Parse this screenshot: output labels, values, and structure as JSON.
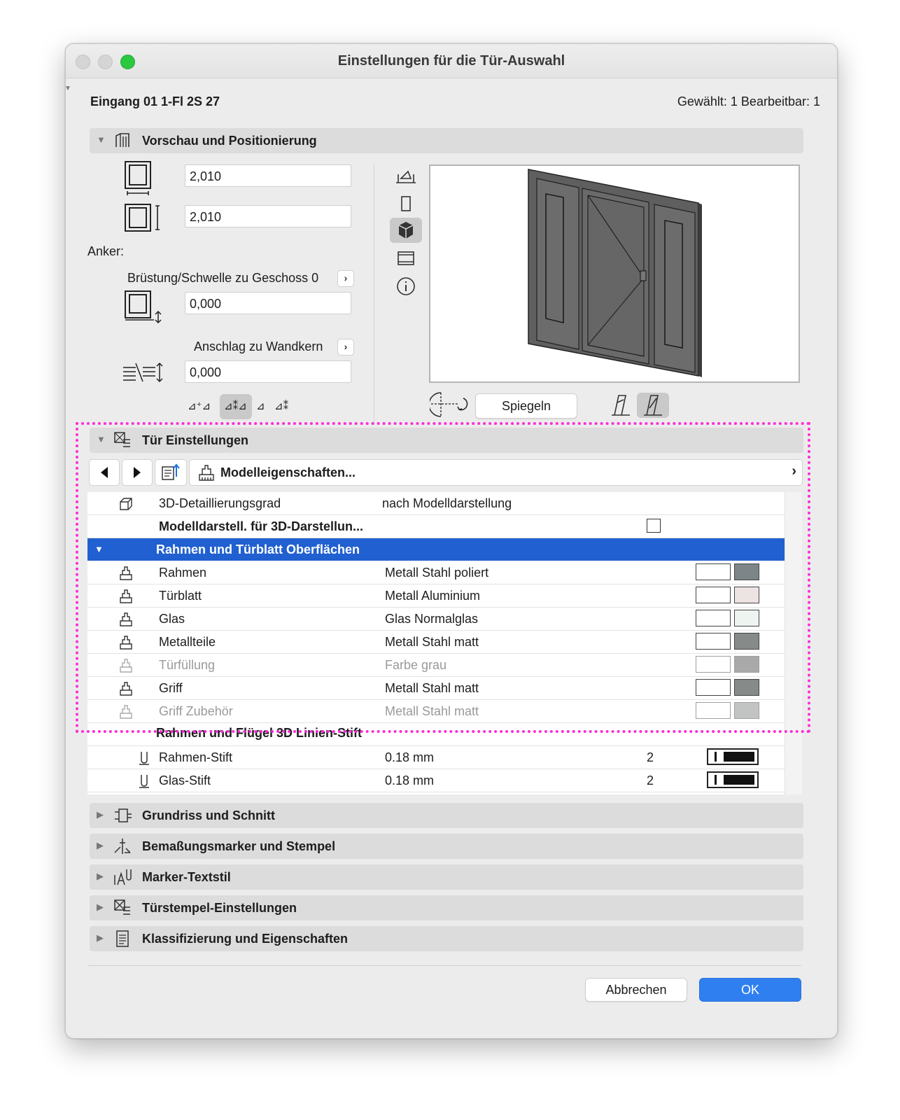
{
  "window": {
    "title": "Einstellungen für die Tür-Auswahl"
  },
  "header": {
    "element_name": "Eingang 01 1-Fl 2S 27",
    "selection_info": "Gewählt: 1 Bearbeitbar: 1"
  },
  "preview_section": {
    "title": "Vorschau und Positionierung",
    "width_value": "2,010",
    "height_value": "2,010",
    "anchor_label": "Anker:",
    "sill_label": "Brüstung/Schwelle zu Geschoss 0",
    "sill_value": "0,000",
    "reveal_label": "Anschlag zu Wandkern",
    "reveal_value": "0,000",
    "mirror_button": "Spiegeln"
  },
  "door_settings": {
    "title": "Tür Einstellungen",
    "dropdown_label": "Modelleigenschaften...",
    "rows": [
      {
        "label": "3D-Detaillierungsgrad",
        "value": "nach Modelldarstellung"
      },
      {
        "label": "Modelldarstell. für 3D-Darstellun..."
      }
    ],
    "surface_group": {
      "label": "Rahmen und Türblatt Oberflächen",
      "items": [
        {
          "label": "Rahmen",
          "value": "Metall Stahl poliert",
          "color": "#7d8589",
          "enabled": true
        },
        {
          "label": "Türblatt",
          "value": "Metall Aluminium",
          "color": "#ece3e3",
          "enabled": true
        },
        {
          "label": "Glas",
          "value": "Glas Normalglas",
          "color": "#eef4ef",
          "enabled": true
        },
        {
          "label": "Metallteile",
          "value": "Metall Stahl matt",
          "color": "#868b89",
          "enabled": true
        },
        {
          "label": "Türfüllung",
          "value": "Farbe grau",
          "color": "#a9a9a9",
          "enabled": false
        },
        {
          "label": "Griff",
          "value": "Metall Stahl matt",
          "color": "#868b89",
          "enabled": true
        },
        {
          "label": "Griff Zubehör",
          "value": "Metall Stahl matt",
          "color": "#c2c4c3",
          "enabled": false
        }
      ]
    },
    "pen_group_label": "Rahmen und Flügel 3D Linien-Stift",
    "pens": [
      {
        "label": "Rahmen-Stift",
        "value": "0.18 mm",
        "pen": "2"
      },
      {
        "label": "Glas-Stift",
        "value": "0.18 mm",
        "pen": "2"
      }
    ]
  },
  "collapsed_sections": [
    {
      "title": "Grundriss und Schnitt",
      "icon": "floorplan-icon"
    },
    {
      "title": "Bemaßungsmarker und Stempel",
      "icon": "dimension-marker-icon"
    },
    {
      "title": "Marker-Textstil",
      "icon": "text-style-icon"
    },
    {
      "title": "Türstempel-Einstellungen",
      "icon": "door-stamp-icon"
    },
    {
      "title": "Klassifizierung und Eigenschaften",
      "icon": "classification-icon"
    }
  ],
  "footer": {
    "cancel": "Abbrechen",
    "ok": "OK"
  },
  "colors": {
    "accent": "#2f7ff0",
    "selection": "#2060d0",
    "highlight": "#ff2bd6"
  }
}
